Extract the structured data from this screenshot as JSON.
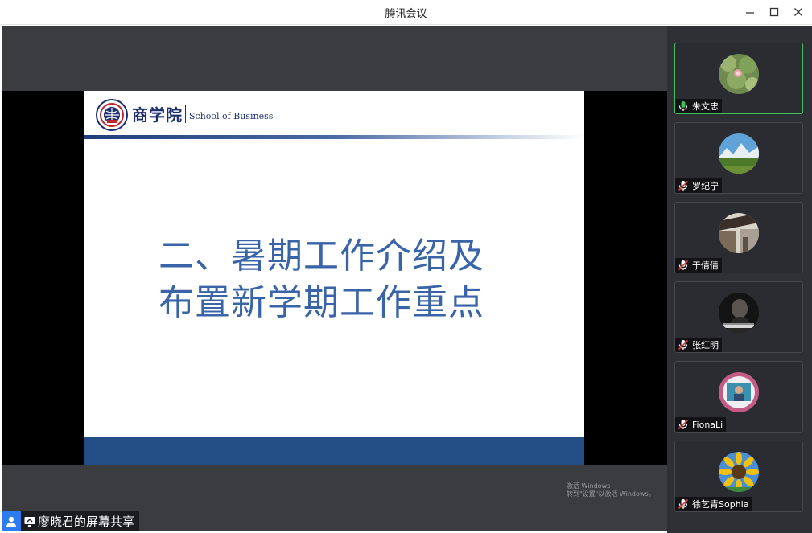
{
  "window": {
    "title": "腾讯会议",
    "minimize_icon": "minimize-icon",
    "maximize_icon": "maximize-icon",
    "close_icon": "close-icon"
  },
  "slide": {
    "school_cn": "商学院",
    "school_en": "School of Business",
    "title_line1": "二、暑期工作介绍及",
    "title_line2": "布置新学期工作重点",
    "colors": {
      "title": "#3a64a8",
      "footer": "#234e86",
      "header_text": "#1d2f6e"
    }
  },
  "watermark": {
    "line1": "激活 Windows",
    "line2": "转到\"设置\"以激活 Windows。"
  },
  "share": {
    "label": "廖晓君的屏幕共享",
    "user_icon": "user-icon",
    "screen_icon": "screen-share-icon"
  },
  "participants": [
    {
      "name": "朱文忠",
      "mic": "mic-on-icon",
      "speaking": true
    },
    {
      "name": "罗纪宁",
      "mic": "mic-muted-icon",
      "speaking": false
    },
    {
      "name": "于倩倩",
      "mic": "mic-muted-icon",
      "speaking": false
    },
    {
      "name": "张红明",
      "mic": "mic-muted-icon",
      "speaking": false
    },
    {
      "name": "FionaLi",
      "mic": "mic-muted-icon",
      "speaking": false
    },
    {
      "name": "徐艺青Sophia",
      "mic": "mic-muted-icon",
      "speaking": false
    }
  ],
  "colors": {
    "speaking_border": "#3ec05d",
    "stage_bg": "#3a3c40",
    "panel_bg": "#2e3035"
  }
}
